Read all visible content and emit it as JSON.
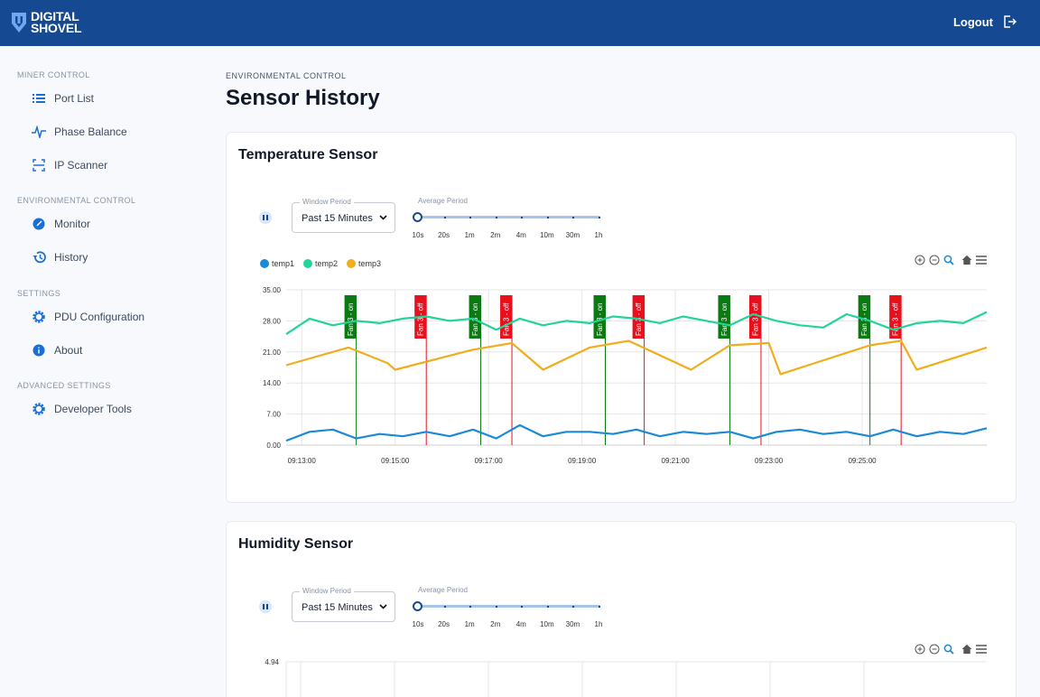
{
  "brand": {
    "line1": "DIGITAL",
    "line2": "SHOVEL"
  },
  "header": {
    "logout_label": "Logout"
  },
  "sidebar": {
    "sections": [
      {
        "label": "MINER CONTROL",
        "items": [
          {
            "label": "Port List",
            "icon": "list-icon"
          },
          {
            "label": "Phase Balance",
            "icon": "pulse-icon"
          },
          {
            "label": "IP Scanner",
            "icon": "scan-icon"
          }
        ]
      },
      {
        "label": "ENVIRONMENTAL CONTROL",
        "items": [
          {
            "label": "Monitor",
            "icon": "gauge-icon"
          },
          {
            "label": "History",
            "icon": "history-icon"
          }
        ]
      },
      {
        "label": "SETTINGS",
        "items": [
          {
            "label": "PDU Configuration",
            "icon": "gear-icon"
          },
          {
            "label": "About",
            "icon": "info-icon"
          }
        ]
      },
      {
        "label": "ADVANCED SETTINGS",
        "items": [
          {
            "label": "Developer Tools",
            "icon": "gear-icon"
          }
        ]
      }
    ]
  },
  "page": {
    "eyebrow": "ENVIRONMENTAL CONTROL",
    "title": "Sensor History"
  },
  "controls": {
    "window_period_label": "Window Period",
    "window_period_value": "Past 15 Minutes",
    "average_period_label": "Average Period",
    "average_period_ticks": [
      "10s",
      "20s",
      "1m",
      "2m",
      "4m",
      "10m",
      "30m",
      "1h"
    ],
    "average_period_selected": "10s"
  },
  "temperature_card": {
    "title": "Temperature Sensor"
  },
  "humidity_card": {
    "title": "Humidity Sensor"
  },
  "colors": {
    "temp1": "#1a8ad8",
    "temp2": "#22d39b",
    "temp3": "#f0ad1d",
    "brand": "#154a93",
    "fan_on": "#0b7a12",
    "fan_off": "#e8101d"
  },
  "chart_data": [
    {
      "type": "line",
      "title": "Temperature Sensor",
      "ylim": [
        0,
        35
      ],
      "yticks": [
        "0.00",
        "7.00",
        "14.00",
        "21.00",
        "28.00",
        "35.00"
      ],
      "xlim": [
        "09:12:40",
        "09:27:40"
      ],
      "xticks": [
        "09:13:00",
        "09:15:00",
        "09:17:00",
        "09:19:00",
        "09:21:00",
        "09:23:00",
        "09:25:00"
      ],
      "grid": true,
      "legend": "top-left",
      "series": [
        {
          "name": "temp1",
          "x": [
            "09:12:40",
            "09:13:10",
            "09:13:40",
            "09:14:10",
            "09:14:40",
            "09:15:10",
            "09:15:40",
            "09:16:10",
            "09:16:40",
            "09:17:10",
            "09:17:40",
            "09:18:10",
            "09:18:40",
            "09:19:10",
            "09:19:40",
            "09:20:10",
            "09:20:40",
            "09:21:10",
            "09:21:40",
            "09:22:10",
            "09:22:40",
            "09:23:10",
            "09:23:40",
            "09:24:10",
            "09:24:40",
            "09:25:10",
            "09:25:40",
            "09:26:10",
            "09:26:40",
            "09:27:10",
            "09:27:40"
          ],
          "values": [
            1.0,
            3.0,
            3.5,
            1.5,
            2.5,
            2.0,
            3.0,
            2.0,
            3.5,
            1.5,
            4.5,
            2.0,
            3.0,
            3.0,
            2.5,
            3.5,
            2.0,
            3.0,
            2.5,
            3.0,
            1.5,
            3.0,
            3.5,
            2.5,
            3.0,
            2.0,
            3.5,
            2.0,
            3.0,
            2.5,
            3.8
          ]
        },
        {
          "name": "temp2",
          "x": [
            "09:12:40",
            "09:13:10",
            "09:13:40",
            "09:14:10",
            "09:14:40",
            "09:15:10",
            "09:15:40",
            "09:16:10",
            "09:16:40",
            "09:17:10",
            "09:17:40",
            "09:18:10",
            "09:18:40",
            "09:19:10",
            "09:19:40",
            "09:20:10",
            "09:20:40",
            "09:21:10",
            "09:21:40",
            "09:22:10",
            "09:22:40",
            "09:23:10",
            "09:23:40",
            "09:24:10",
            "09:24:40",
            "09:25:10",
            "09:25:40",
            "09:26:10",
            "09:26:40",
            "09:27:10",
            "09:27:40"
          ],
          "values": [
            25.0,
            28.5,
            27.0,
            28.0,
            27.5,
            28.5,
            29.0,
            28.0,
            28.5,
            26.0,
            28.5,
            27.0,
            28.0,
            27.5,
            29.0,
            28.5,
            27.5,
            29.0,
            28.0,
            27.0,
            29.5,
            28.0,
            27.0,
            26.5,
            29.5,
            28.0,
            26.0,
            27.5,
            28.0,
            27.5,
            30.0
          ]
        },
        {
          "name": "temp3",
          "x": [
            "09:12:40",
            "09:14:00",
            "09:14:50",
            "09:15:00",
            "09:16:40",
            "09:17:30",
            "09:18:10",
            "09:19:10",
            "09:20:00",
            "09:21:20",
            "09:22:10",
            "09:23:00",
            "09:23:15",
            "09:25:10",
            "09:25:50",
            "09:26:10",
            "09:27:40"
          ],
          "values": [
            18.0,
            22.0,
            18.5,
            17.0,
            21.5,
            23.0,
            17.0,
            22.0,
            23.5,
            17.0,
            22.5,
            23.0,
            16.0,
            22.5,
            23.5,
            17.0,
            22.0
          ]
        }
      ],
      "annotations": [
        {
          "x": "09:14:10",
          "label": "Fan 3 - on",
          "color": "#0b7a12"
        },
        {
          "x": "09:15:40",
          "label": "Fan 3 - off",
          "color": "#e8101d"
        },
        {
          "x": "09:16:50",
          "label": "Fan 3 - on",
          "color": "#0b7a12"
        },
        {
          "x": "09:17:30",
          "label": "Fan 3 - off",
          "color": "#e8101d"
        },
        {
          "x": "09:19:30",
          "label": "Fan 3 - on",
          "color": "#0b7a12"
        },
        {
          "x": "09:20:20",
          "label": "Fan 3 - off",
          "color": "#e8101d"
        },
        {
          "x": "09:22:10",
          "label": "Fan 3 - on",
          "color": "#0b7a12"
        },
        {
          "x": "09:22:50",
          "label": "Fan 3 - off",
          "color": "#e8101d"
        },
        {
          "x": "09:25:10",
          "label": "Fan 3 - on",
          "color": "#0b7a12"
        },
        {
          "x": "09:25:50",
          "label": "Fan 3 - off",
          "color": "#e8101d"
        }
      ]
    },
    {
      "type": "line",
      "title": "Humidity Sensor",
      "yticks": [
        "4.94"
      ],
      "grid": true,
      "series": []
    }
  ]
}
